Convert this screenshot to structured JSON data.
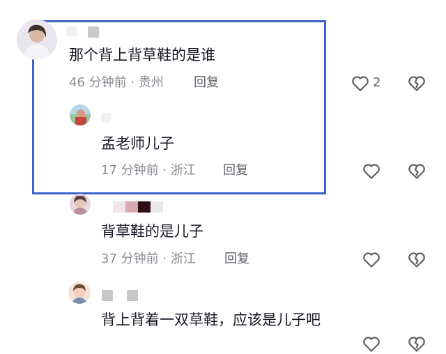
{
  "comments": [
    {
      "text": "那个背上背草鞋的是谁",
      "time": "46 分钟前",
      "location": "贵州",
      "reply_label": "回复",
      "like_count": "2",
      "icons": {
        "like": "heart-outline-icon",
        "dislike": "broken-heart-icon"
      }
    },
    {
      "text": "孟老师儿子",
      "time": "17 分钟前",
      "location": "浙江",
      "reply_label": "回复",
      "icons": {
        "like": "heart-outline-icon",
        "dislike": "broken-heart-icon"
      }
    },
    {
      "text": "背草鞋的是儿子",
      "time": "37 分钟前",
      "location": "浙江",
      "reply_label": "回复",
      "icons": {
        "like": "heart-outline-icon",
        "dislike": "broken-heart-icon"
      }
    },
    {
      "text": "背上背着一双草鞋，应该是儿子吧",
      "icons": {
        "like": "heart-outline-icon",
        "dislike": "broken-heart-icon"
      }
    }
  ],
  "meta_separator": "·",
  "colors": {
    "highlight_border": "#3a63c9",
    "text": "#161823",
    "meta": "#8a8b91"
  }
}
